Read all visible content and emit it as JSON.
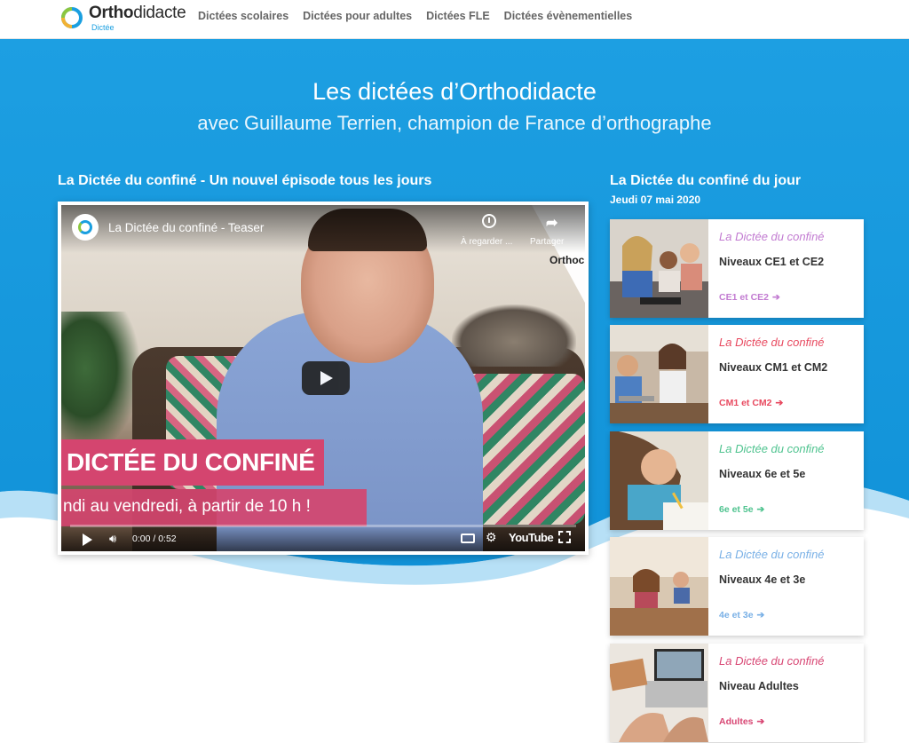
{
  "header": {
    "logo_bold": "Ortho",
    "logo_light": "didacte",
    "logo_sub": "Dictée",
    "nav": [
      "Dictées scolaires",
      "Dictées pour adultes",
      "Dictées FLE",
      "Dictées évènementielles"
    ]
  },
  "hero": {
    "title": "Les dictées d’Orthodidacte",
    "subtitle": "avec Guillaume Terrien, champion de France d’orthographe"
  },
  "main": {
    "section_title": "La Dictée du confiné - Un nouvel épisode tous les jours",
    "video": {
      "title": "La Dictée du confiné - Teaser",
      "watch_later": "À regarder ...",
      "share": "Partager",
      "brand_overlay": "Orthoc",
      "banner_main": "DICTÉE DU CONFINÉ",
      "banner_sub": "ndi au vendredi, à partir de 10 h !",
      "time": "0:00 / 0:52",
      "youtube": "YouTube"
    }
  },
  "sidebar": {
    "title": "La Dictée du confiné du jour",
    "date": "Jeudi 07 mai 2020",
    "cards": [
      {
        "brand": "La Dictée du confiné",
        "level": "Niveaux CE1 et CE2",
        "link": "CE1 et CE2",
        "color": "#c27bd1"
      },
      {
        "brand": "La Dictée du confiné",
        "level": "Niveaux CM1 et CM2",
        "link": "CM1 et CM2",
        "color": "#e8495f"
      },
      {
        "brand": "La Dictée du confiné",
        "level": "Niveaux 6e et 5e",
        "link": "6e et 5e",
        "color": "#4fc38f"
      },
      {
        "brand": "La Dictée du confiné",
        "level": "Niveaux 4e et 3e",
        "link": "4e et 3e",
        "color": "#79b0e6"
      },
      {
        "brand": "La Dictée du confiné",
        "level": "Niveau Adultes",
        "link": "Adultes",
        "color": "#d84774"
      }
    ]
  },
  "colors": {
    "hero_blue": "#1a9fe0",
    "banner_pink": "#d4456f"
  }
}
